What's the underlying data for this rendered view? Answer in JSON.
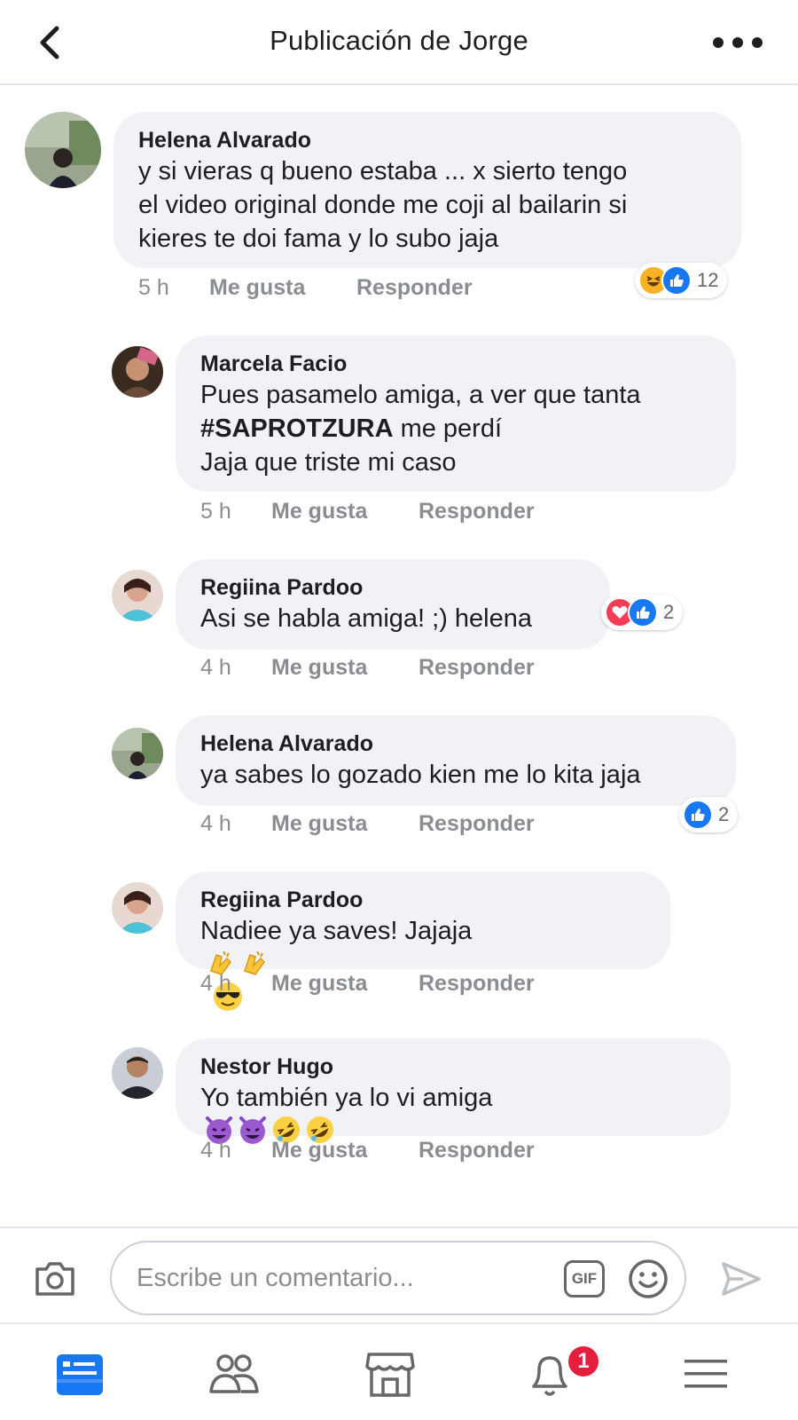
{
  "header": {
    "title": "Publicación de Jorge",
    "back_icon": "chevron-left-icon",
    "more_icon": "more-dots-icon"
  },
  "comments": [
    {
      "author": "Helena Alvarado",
      "text": "y si vieras q bueno estaba ... x sierto tengo\nel video original donde me coji al bailarin si\nkieres te doi fama y lo subo jaja",
      "time": "5 h",
      "like_label": "Me gusta",
      "reply_label": "Responder",
      "reactions": [
        "haha",
        "like"
      ],
      "reaction_count": "12"
    },
    {
      "author": "Marcela Facio",
      "text_line1": "Pues pasamelo amiga, a ver que tanta",
      "hashtag": "#SAPROTZURA",
      "text_after_hashtag": " me perdí",
      "text_line3": "Jaja que triste mi caso",
      "time": "5 h",
      "like_label": "Me gusta",
      "reply_label": "Responder"
    },
    {
      "author": "Regiina Pardoo",
      "text": "Asi se habla amiga! ;) helena",
      "time": "4 h",
      "like_label": "Me gusta",
      "reply_label": "Responder",
      "reactions": [
        "love",
        "like"
      ],
      "reaction_count": "2"
    },
    {
      "author": "Helena Alvarado",
      "text": "ya sabes lo gozado kien me lo kita jaja",
      "time": "4 h",
      "like_label": "Me gusta",
      "reply_label": "Responder",
      "reactions": [
        "like"
      ],
      "reaction_count": "2"
    },
    {
      "author": "Regiina Pardoo",
      "text": "Nadiee ya saves! Jajaja",
      "emojis": [
        "clapping-hands",
        "clapping-hands",
        "smiling-face-sunglasses"
      ],
      "time": "4 h",
      "like_label": "Me gusta",
      "reply_label": "Responder"
    },
    {
      "author": "Nestor Hugo",
      "text": "Yo también ya lo vi amiga",
      "emojis": [
        "smiling-devil",
        "smiling-devil",
        "rofl",
        "rofl"
      ],
      "time": "4 h",
      "like_label": "Me gusta",
      "reply_label": "Responder"
    }
  ],
  "compose": {
    "placeholder": "Escribe un comentario...",
    "gif_label": "GIF"
  },
  "bottom_nav": {
    "items": [
      "news-feed-icon",
      "friends-icon",
      "marketplace-icon",
      "notifications-icon",
      "menu-icon"
    ],
    "notification_count": "1"
  },
  "colors": {
    "accent": "#1877f2",
    "bubble": "#f0f2f5",
    "meta_text": "#8a8d91",
    "badge": "#e41e3f"
  }
}
